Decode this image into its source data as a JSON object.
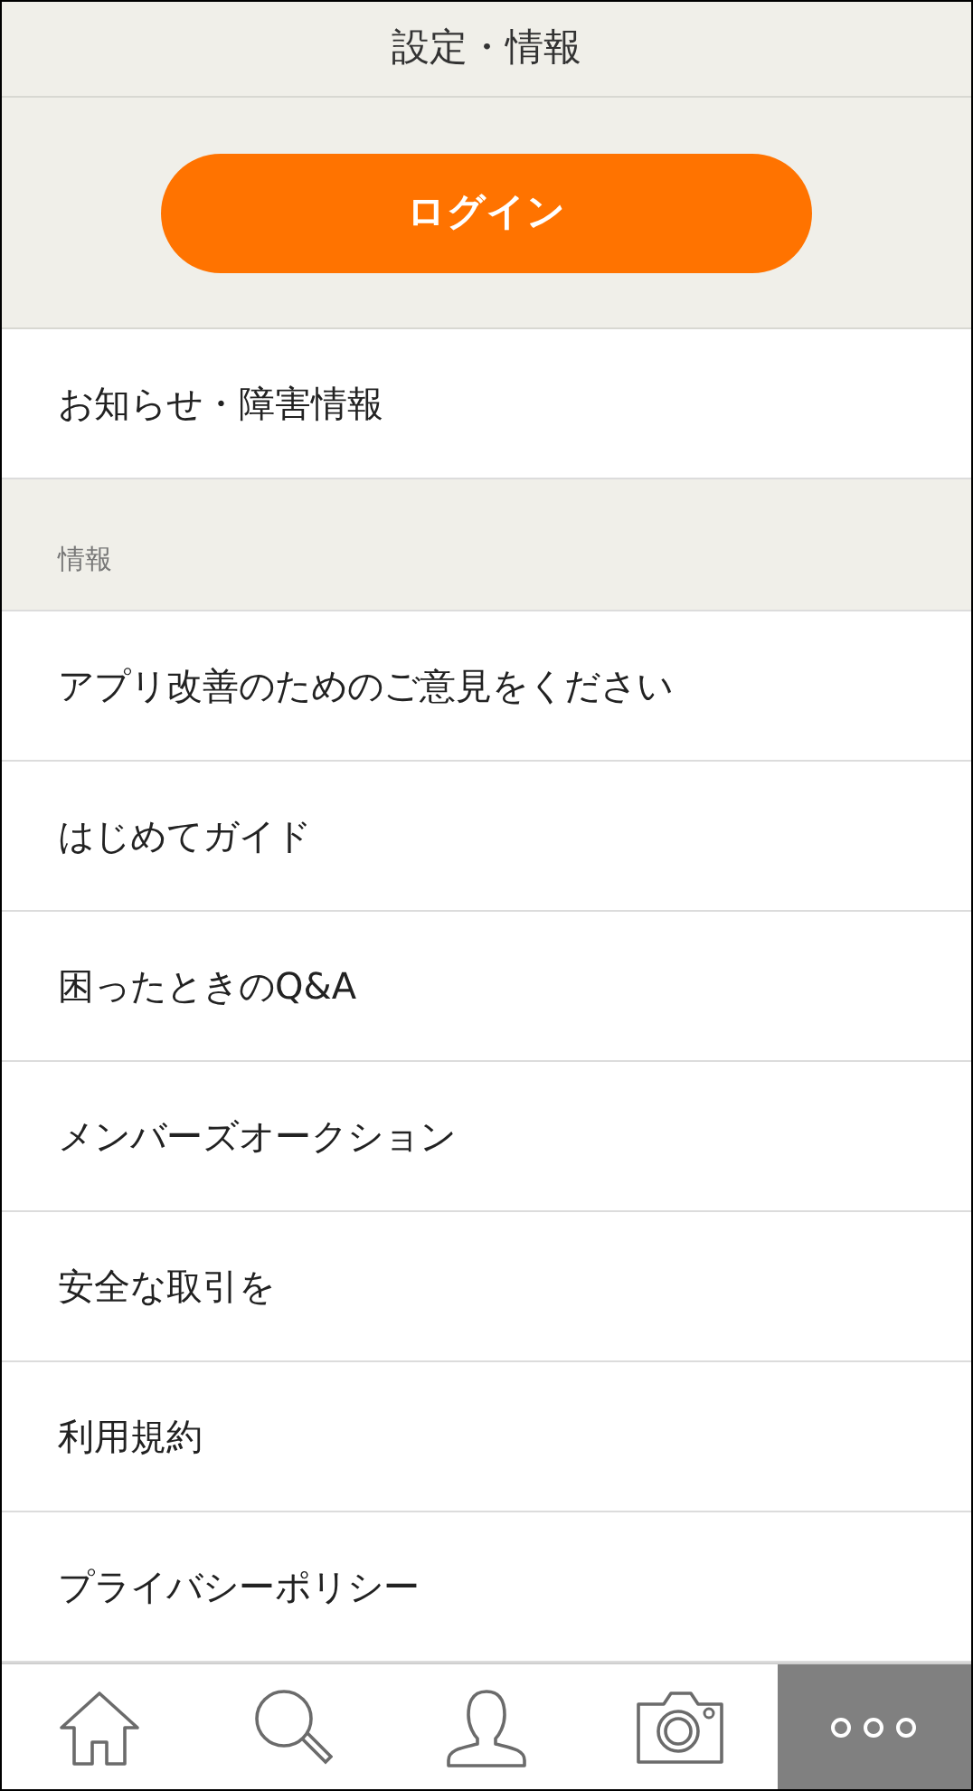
{
  "header": {
    "title": "設定・情報"
  },
  "login_button": {
    "label": "ログイン"
  },
  "top_items": [
    {
      "label": "お知らせ・障害情報"
    }
  ],
  "section": {
    "title": "情報",
    "items": [
      {
        "label": "アプリ改善のためのご意見をください"
      },
      {
        "label": "はじめてガイド"
      },
      {
        "label": "困ったときのQ&A"
      },
      {
        "label": "メンバーズオークション"
      },
      {
        "label": "安全な取引を"
      },
      {
        "label": "利用規約"
      },
      {
        "label": "プライバシーポリシー"
      }
    ]
  },
  "tabs": [
    {
      "kind": "home",
      "selected": false
    },
    {
      "kind": "search",
      "selected": false
    },
    {
      "kind": "person",
      "selected": false
    },
    {
      "kind": "camera",
      "selected": false
    },
    {
      "kind": "more",
      "selected": true
    }
  ]
}
